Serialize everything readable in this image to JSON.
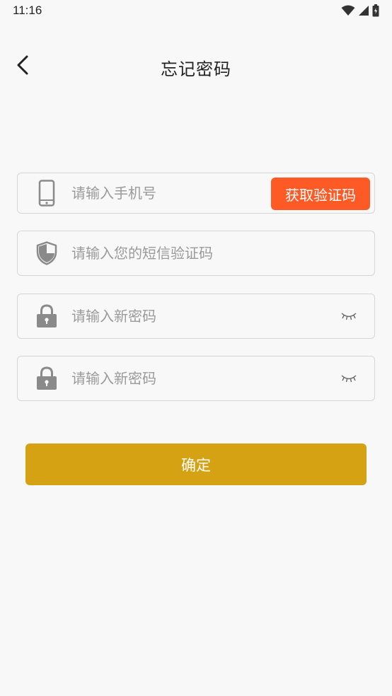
{
  "status_bar": {
    "time": "11:16",
    "icons": [
      "wifi-icon",
      "signal-icon",
      "battery-icon"
    ]
  },
  "header": {
    "title": "忘记密码",
    "back_icon": "chevron-left-icon"
  },
  "form": {
    "phone": {
      "placeholder": "请输入手机号",
      "value": "",
      "icon": "phone-icon",
      "get_code_label": "获取验证码"
    },
    "sms_code": {
      "placeholder": "请输入您的短信验证码",
      "value": "",
      "icon": "shield-icon"
    },
    "new_password": {
      "placeholder": "请输入新密码",
      "value": "",
      "icon": "lock-icon",
      "toggle_icon": "eye-closed-icon"
    },
    "confirm_password": {
      "placeholder": "请输入新密码",
      "value": "",
      "icon": "lock-icon",
      "toggle_icon": "eye-closed-icon"
    },
    "confirm_label": "确定"
  },
  "colors": {
    "get_code_button": "#fe5a26",
    "confirm_button": "#d4a212",
    "icon_gray": "#8a8a8a",
    "background": "#f8f8f8"
  }
}
